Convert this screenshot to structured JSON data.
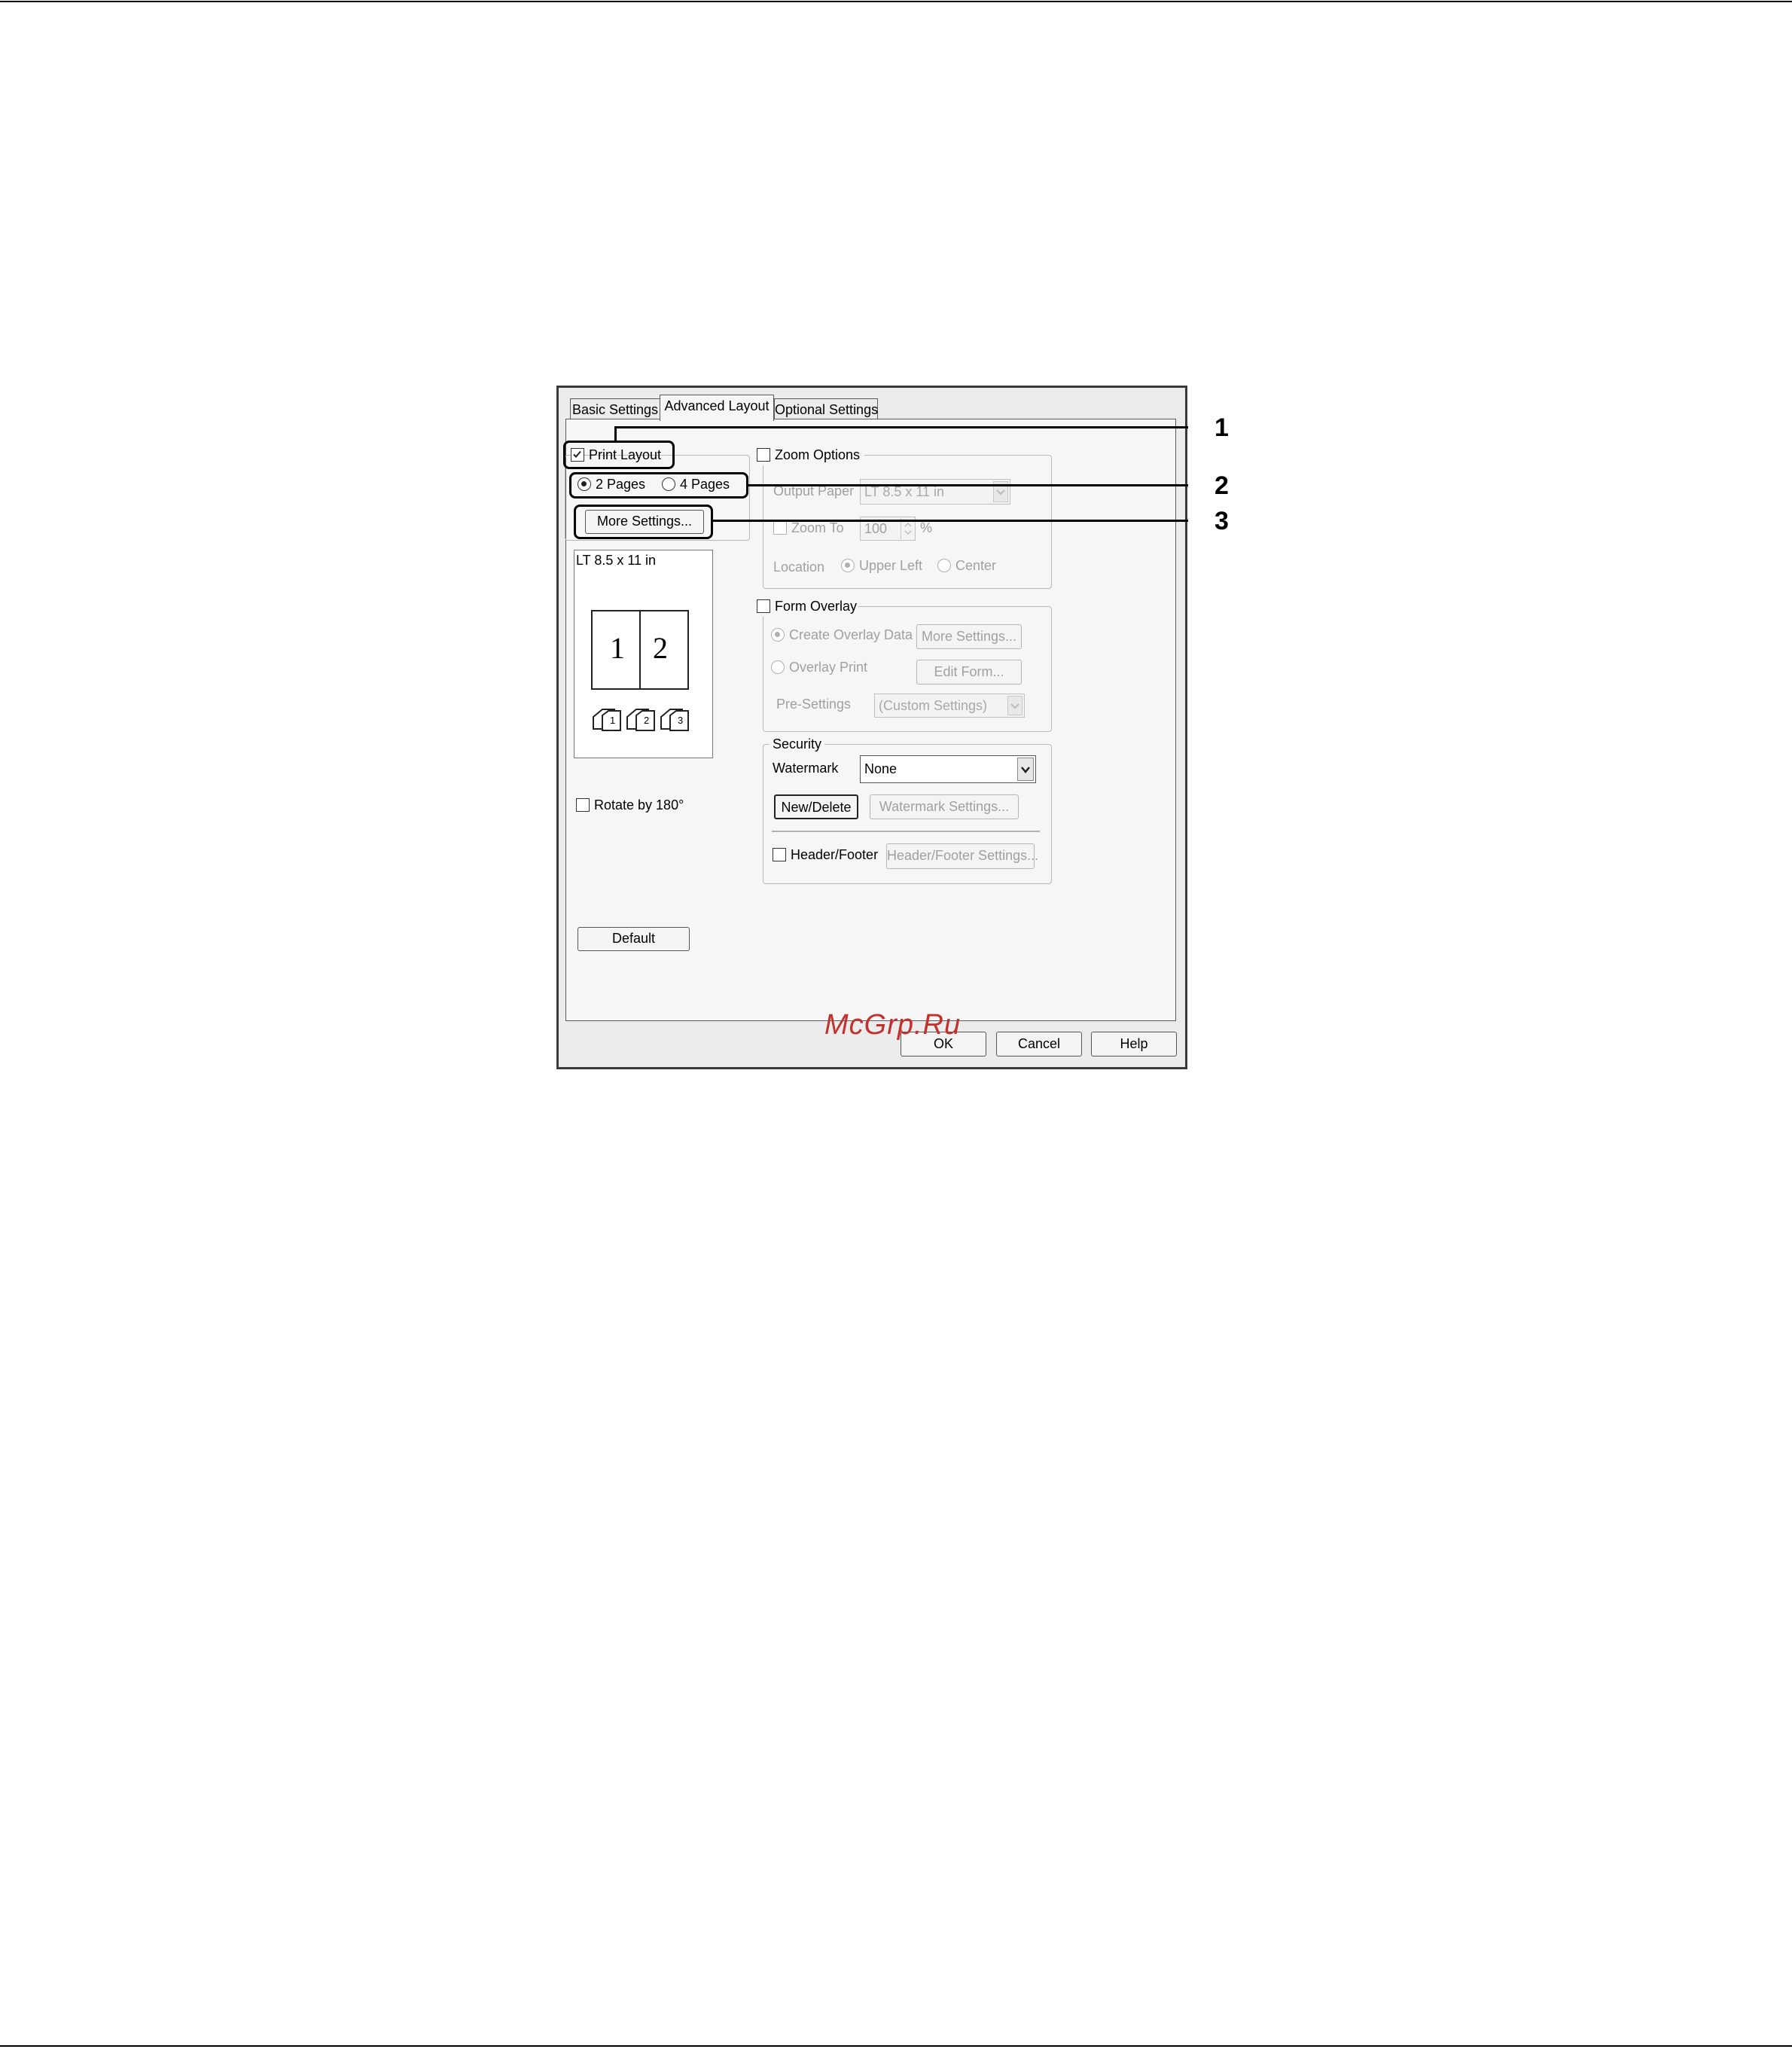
{
  "tabs": [
    {
      "label": "Basic Settings",
      "active": false
    },
    {
      "label": "Advanced Layout",
      "active": true
    },
    {
      "label": "Optional Settings",
      "active": false
    }
  ],
  "print_layout": {
    "label": "Print Layout",
    "checked": true,
    "options": [
      "2 Pages",
      "4 Pages"
    ],
    "selected": "2 Pages",
    "more_settings_label": "More Settings...",
    "paper_label": "LT 8.5 x 11 in",
    "preview_page_numbers": [
      "1",
      "2"
    ],
    "order_icon_digits": [
      "1",
      "2",
      "3"
    ],
    "rotate_label": "Rotate by 180°"
  },
  "zoom_options": {
    "label": "Zoom Options",
    "output_paper_label": "Output Paper",
    "output_paper_value": "LT 8.5 x 11 in",
    "zoom_to_label": "Zoom To",
    "zoom_value": "100",
    "percent": "%",
    "location_label": "Location",
    "location_options": [
      "Upper Left",
      "Center"
    ]
  },
  "form_overlay": {
    "label": "Form Overlay",
    "create_label": "Create Overlay Data",
    "create_button": "More Settings...",
    "overlay_print_label": "Overlay Print",
    "edit_form_button": "Edit Form...",
    "presettings_label": "Pre-Settings",
    "presettings_value": "(Custom Settings)"
  },
  "security": {
    "label": "Security",
    "watermark_label": "Watermark",
    "watermark_value": "None",
    "new_delete_button": "New/Delete",
    "watermark_settings_button": "Watermark Settings...",
    "header_footer_label": "Header/Footer",
    "header_footer_button": "Header/Footer Settings..."
  },
  "buttons": {
    "default": "Default",
    "ok": "OK",
    "cancel": "Cancel",
    "help": "Help"
  },
  "callouts": [
    "1",
    "2",
    "3"
  ],
  "watermark_site": "McGrp.Ru"
}
